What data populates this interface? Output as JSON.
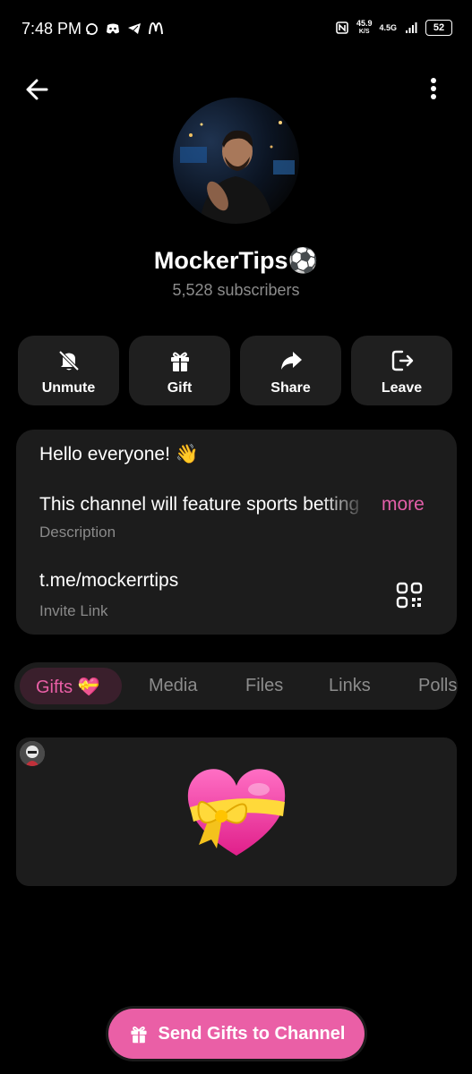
{
  "status_bar": {
    "time": "7:48 PM",
    "battery": "52",
    "net_speed_value": "45.9",
    "net_speed_unit": "K/S",
    "signal_label": "4.5G"
  },
  "channel": {
    "name": "MockerTips⚽",
    "subscribers": "5,528 subscribers"
  },
  "actions": [
    {
      "label": "Unmute",
      "icon": "bell-off-icon"
    },
    {
      "label": "Gift",
      "icon": "gift-icon"
    },
    {
      "label": "Share",
      "icon": "share-icon"
    },
    {
      "label": "Leave",
      "icon": "leave-icon"
    }
  ],
  "info": {
    "greeting": "Hello everyone! 👋",
    "description": "This channel will feature sports betting",
    "more": "more",
    "description_label": "Description",
    "invite_link": "t.me/mockerrtips",
    "invite_label": "Invite Link"
  },
  "tabs": [
    {
      "label": "Gifts 💝",
      "active": true
    },
    {
      "label": "Media"
    },
    {
      "label": "Files"
    },
    {
      "label": "Links"
    },
    {
      "label": "Polls"
    }
  ],
  "gift_item": {
    "emoji": "💝"
  },
  "bottom_button": {
    "label": "Send Gifts to Channel"
  },
  "colors": {
    "accent": "#ea5fa6",
    "more_link": "#e35fa9",
    "card_bg": "#1c1c1c",
    "background": "#000000"
  }
}
